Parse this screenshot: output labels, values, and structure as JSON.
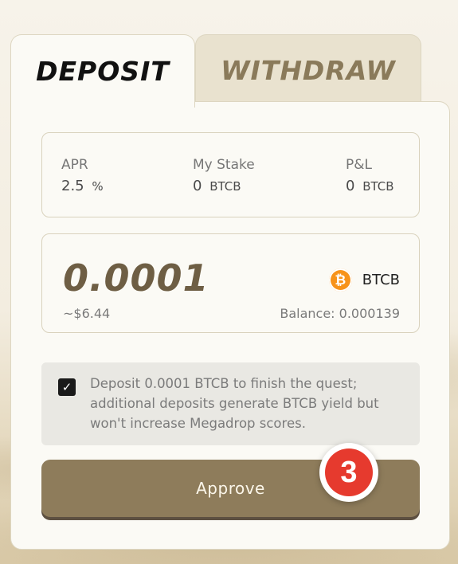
{
  "tabs": {
    "deposit": "DEPOSIT",
    "withdraw": "WITHDRAW"
  },
  "stats": {
    "apr": {
      "label": "APR",
      "value": "2.5",
      "unit": "%"
    },
    "stake": {
      "label": "My Stake",
      "value": "0",
      "unit": "BTCB"
    },
    "pl": {
      "label": "P&L",
      "value": "0",
      "unit": "BTCB"
    }
  },
  "amount": {
    "value": "0.0001",
    "usd": "~$6.44",
    "token": "BTCB",
    "token_icon": "bitcoin-icon",
    "coin_glyph": "₿",
    "balance": "Balance: 0.000139"
  },
  "notice": {
    "checked": true,
    "checkmark": "✓",
    "text": "Deposit 0.0001 BTCB to finish the quest; additional deposits generate BTCB yield but won't increase Megadrop scores."
  },
  "approve_label": "Approve",
  "step_badge": "3",
  "colors": {
    "accent": "#8e7c5b",
    "coin": "#f7931a",
    "badge": "#e63a2e"
  }
}
